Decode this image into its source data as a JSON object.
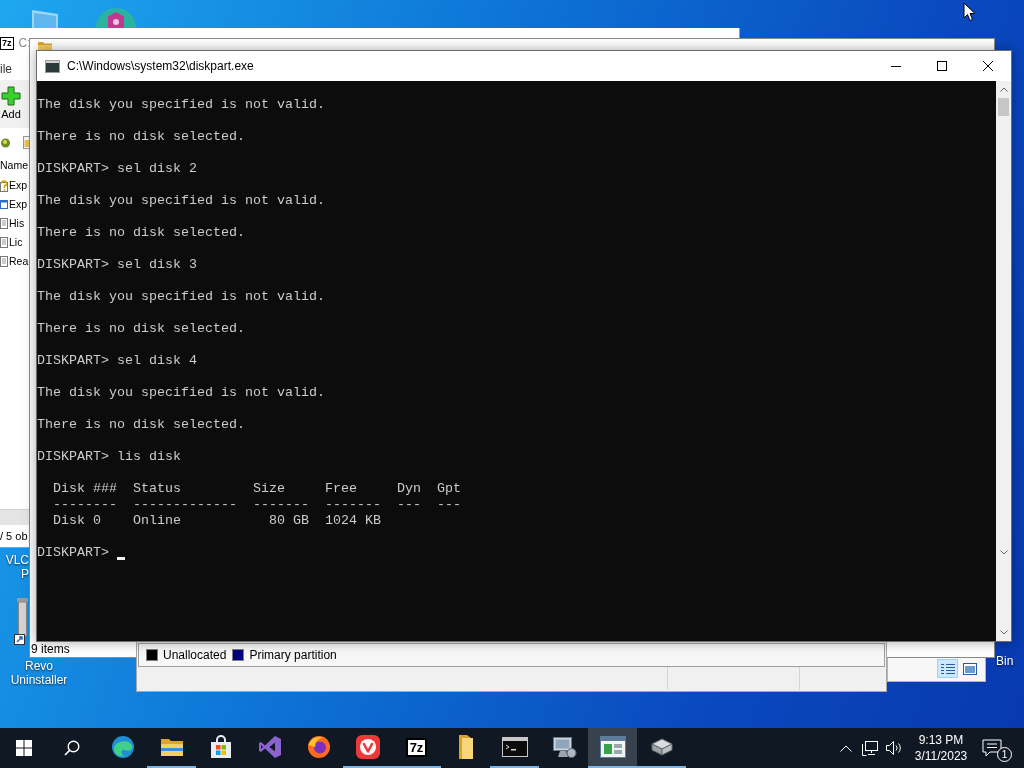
{
  "desktop_icons": [
    {
      "label_lines": [
        "VLC",
        "P"
      ]
    },
    {
      "label_lines": [
        "Revo",
        "Uninstaller"
      ]
    },
    {
      "label_lines": [
        "Bin"
      ]
    }
  ],
  "file_manager_window": {
    "logo": "7z",
    "title": "C:",
    "menu": [
      "ile"
    ],
    "toolbar": [
      {
        "label": "Add"
      }
    ],
    "column_header": "Name",
    "files": [
      {
        "name": "Exp",
        "kind": "help"
      },
      {
        "name": "Exp",
        "kind": "window"
      },
      {
        "name": "His",
        "kind": "document"
      },
      {
        "name": "Lic",
        "kind": "document"
      },
      {
        "name": "Rea",
        "kind": "document"
      }
    ],
    "status": "/ 5 ob"
  },
  "explorer_window": {
    "status": "9 items",
    "views": [
      {
        "kind": "details",
        "selected": true
      },
      {
        "kind": "preview",
        "selected": false
      }
    ]
  },
  "disk_window": {
    "legend": [
      {
        "label": "Unallocated",
        "color": "#000000"
      },
      {
        "label": "Primary partition",
        "color": "#000080"
      }
    ]
  },
  "console_window": {
    "title": "C:\\Windows\\system32\\diskpart.exe",
    "blocks": [
      [
        "The disk you specified is not valid."
      ],
      [
        "There is no disk selected."
      ],
      [
        "DISKPART> sel disk 2"
      ],
      [
        "The disk you specified is not valid."
      ],
      [
        "There is no disk selected."
      ],
      [
        "DISKPART> sel disk 3"
      ],
      [
        "The disk you specified is not valid."
      ],
      [
        "There is no disk selected."
      ],
      [
        "DISKPART> sel disk 4"
      ],
      [
        "The disk you specified is not valid."
      ],
      [
        "There is no disk selected."
      ],
      [
        "DISKPART> lis disk"
      ],
      [
        "  Disk ###  Status         Size     Free     Dyn  Gpt",
        "  --------  -------------  -------  -------  ---  ---",
        "  Disk 0    Online           80 GB  1024 KB"
      ]
    ],
    "prompt": "DISKPART>"
  },
  "taskbar": {
    "apps": [
      {
        "kind": "swirl",
        "running": false,
        "selected": false
      },
      {
        "kind": "folder",
        "running": true,
        "selected": false
      },
      {
        "kind": "bag",
        "running": false,
        "selected": false
      },
      {
        "kind": "ribbon",
        "running": false,
        "selected": false
      },
      {
        "kind": "fox",
        "running": false,
        "selected": false
      },
      {
        "kind": "vmark",
        "running": true,
        "selected": false
      },
      {
        "kind": "text_logo",
        "logo": "7z",
        "running": true,
        "selected": false
      },
      {
        "kind": "tall_folder",
        "running": false,
        "selected": false
      },
      {
        "kind": "terminal",
        "running": true,
        "selected": false
      },
      {
        "kind": "computer",
        "running": false,
        "selected": false
      },
      {
        "kind": "disk_window",
        "running": true,
        "selected": true
      },
      {
        "kind": "drive",
        "running": true,
        "selected": false
      }
    ],
    "clock": {
      "time": "9:13 PM",
      "date": "3/11/2023"
    },
    "notification_count": "1"
  }
}
